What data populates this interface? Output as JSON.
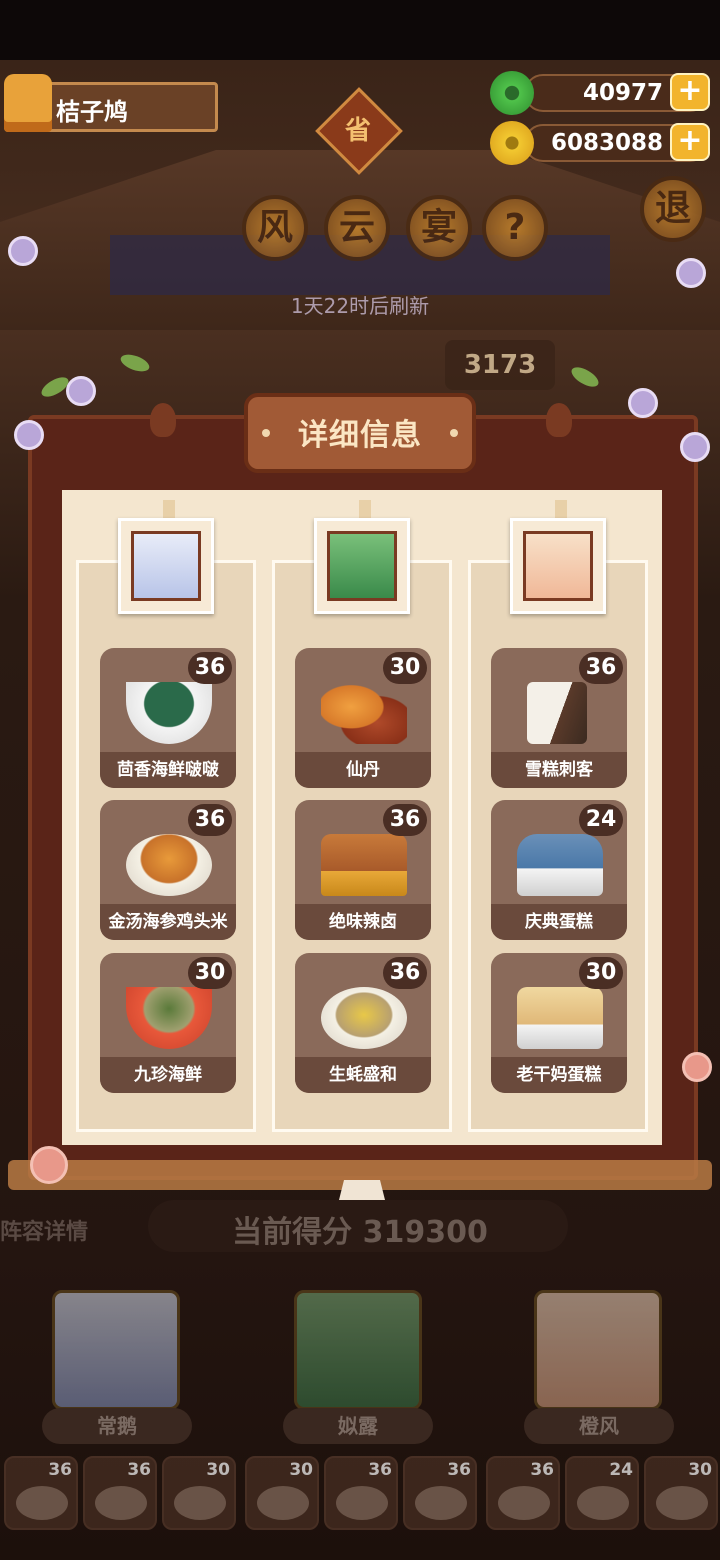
{
  "header": {
    "player_name": "桔子鸠",
    "jade_amount": "40977",
    "coin_amount": "6083088",
    "plus_label": "+",
    "province_label": "省",
    "event_title_chars": [
      "风",
      "云",
      "宴"
    ],
    "help_label": "?",
    "exit_label": "退",
    "refresh_text": "1天22时后刷新",
    "rank_score": "3173"
  },
  "modal": {
    "title": "详细信息",
    "columns": [
      {
        "character": "常鹅",
        "dishes": [
          {
            "name": "茴香海鲜啵啵",
            "level": "36"
          },
          {
            "name": "金汤海参鸡头米",
            "level": "36"
          },
          {
            "name": "九珍海鲜",
            "level": "30"
          }
        ]
      },
      {
        "character": "姒露",
        "dishes": [
          {
            "name": "仙丹",
            "level": "30"
          },
          {
            "name": "绝味辣卤",
            "level": "36"
          },
          {
            "name": "生蚝盛和",
            "level": "36"
          }
        ]
      },
      {
        "character": "橙风",
        "dishes": [
          {
            "name": "雪糕刺客",
            "level": "36"
          },
          {
            "name": "庆典蛋糕",
            "level": "24"
          },
          {
            "name": "老干妈蛋糕",
            "level": "30"
          }
        ]
      }
    ]
  },
  "bottom": {
    "lineup_label": "阵容详情",
    "current_score_label": "当前得分",
    "current_score": "319300",
    "heroes": [
      "常鹅",
      "姒露",
      "橙风"
    ],
    "slot_levels": [
      "36",
      "36",
      "30",
      "30",
      "36",
      "36",
      "36",
      "24",
      "30"
    ]
  },
  "colors": {
    "board": "#5a2418",
    "paper": "#f4e6cf",
    "card": "#8a6a5a",
    "title_plate": "#a15a36",
    "gold": "#f2b42c",
    "jade": "#3aa83a"
  }
}
